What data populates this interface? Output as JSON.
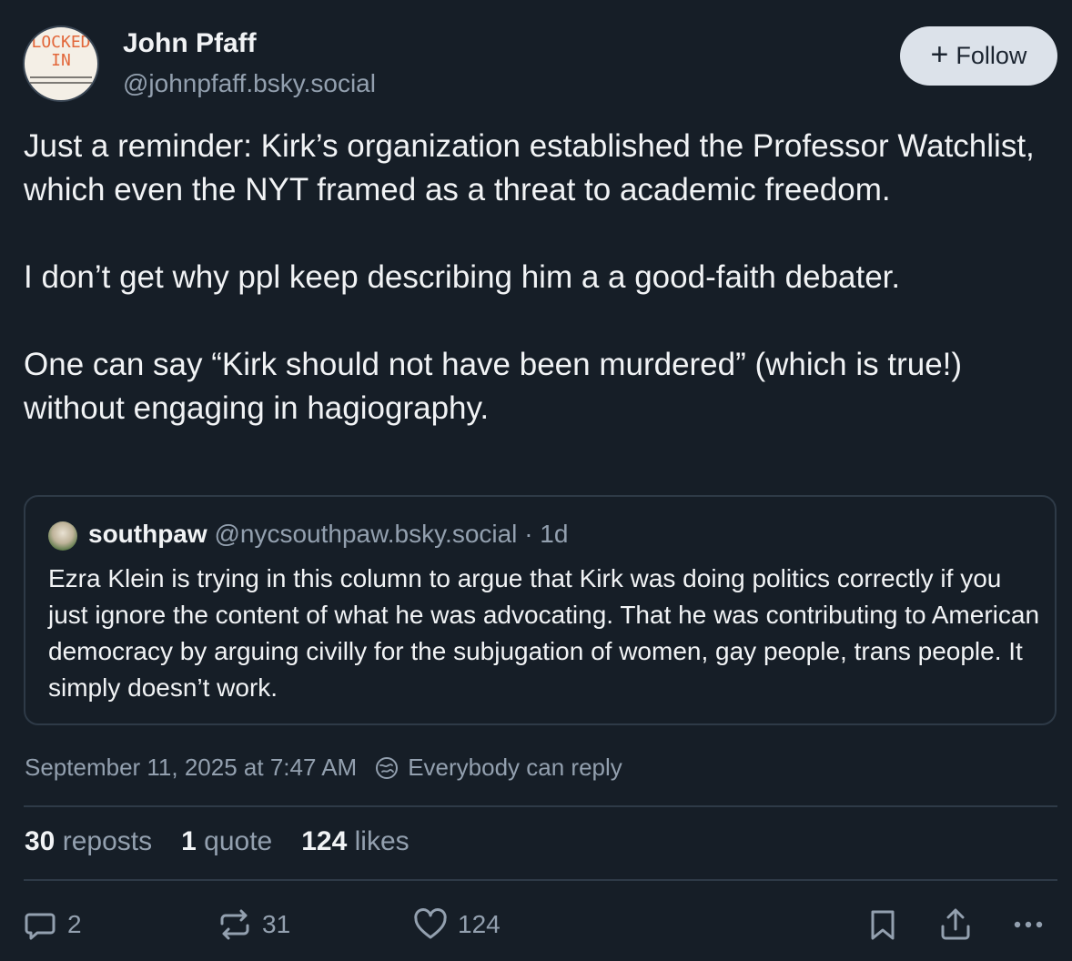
{
  "author": {
    "name": "John Pfaff",
    "handle": "@johnpfaff.bsky.social",
    "avatar": {
      "line1": "LOCKED",
      "line2": "IN"
    }
  },
  "follow_button": {
    "icon": "plus-icon",
    "label": "Follow"
  },
  "post": {
    "paragraphs": [
      "Just a reminder: Kirk’s organization established the Professor Watchlist, which even the NYT framed as a threat to academic freedom.",
      "I don’t get why ppl keep describing him a a good-faith debater.",
      "One can say “Kirk should not have been murdered” (which is true!) without engaging in hagiography."
    ]
  },
  "quote": {
    "name": "southpaw",
    "handle": "@nycsouthpaw.bsky.social",
    "separator": "·",
    "age": "1d",
    "text": "Ezra Klein is trying in this column to argue that Kirk was doing politics correctly if you just ignore the content of what he was advocating. That he was contributing to American democracy by arguing civilly for the subjugation of women, gay people, trans people. It simply doesn’t work."
  },
  "meta": {
    "timestamp": "September 11, 2025 at 7:47 AM",
    "reply_setting": "Everybody can reply",
    "reply_icon": "globe-icon"
  },
  "stats": {
    "reposts_count": "30",
    "reposts_label": "reposts",
    "quotes_count": "1",
    "quotes_label": "quote",
    "likes_count": "124",
    "likes_label": "likes"
  },
  "actions": {
    "reply": {
      "icon": "reply-bubble-icon",
      "count": "2"
    },
    "repost": {
      "icon": "repost-icon",
      "count": "31"
    },
    "like": {
      "icon": "heart-icon",
      "count": "124"
    },
    "bookmark": {
      "icon": "bookmark-icon"
    },
    "share": {
      "icon": "share-icon"
    },
    "more": {
      "icon": "more-options-icon"
    }
  },
  "colors": {
    "background": "#161e27",
    "text_primary": "#f1f3f5",
    "text_secondary": "#93a0af",
    "border": "#2e3a47",
    "follow_button_bg": "#dce2ea"
  }
}
